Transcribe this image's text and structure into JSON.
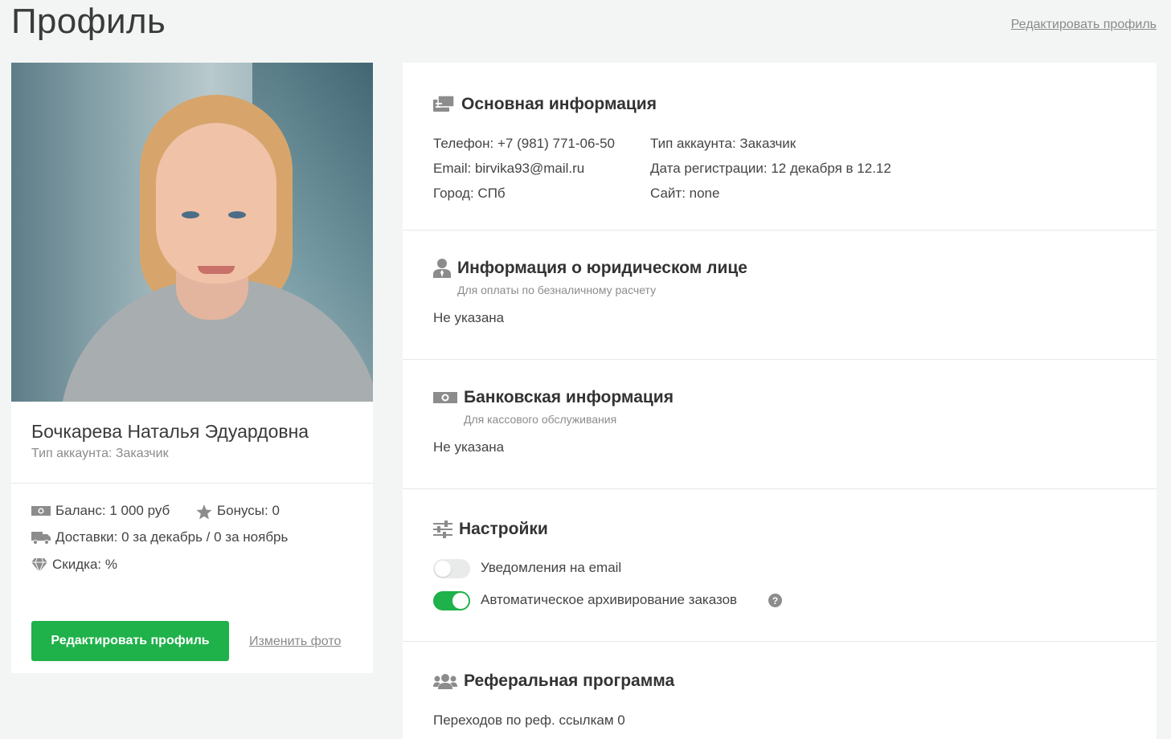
{
  "header": {
    "title": "Профиль",
    "edit_link": "Редактировать профиль"
  },
  "profile": {
    "name": "Бочкарева Наталья Эдуардовна",
    "account_type": "Тип аккаунта: Заказчик",
    "stats": {
      "balance": "Баланс: 1 000 руб",
      "bonuses": "Бонусы: 0",
      "deliveries": "Доставки: 0 за декабрь / 0 за ноябрь",
      "discount": "Скидка: %"
    },
    "edit_button": "Редактировать профиль",
    "change_photo": "Изменить фото"
  },
  "basic_info": {
    "title": "Основная информация",
    "phone": "Телефон: +7 (981) 771-06-50",
    "email": "Email: birvika93@mail.ru",
    "city": "Город: СПб",
    "account_type": "Тип аккаунта: Заказчик",
    "registered": "Дата регистрации: 12 декабря в 12.12",
    "site": "Сайт: none"
  },
  "legal_info": {
    "title": "Информация о юридическом лице",
    "subtitle": "Для оплаты по безналичному расчету",
    "value": "Не указана"
  },
  "bank_info": {
    "title": "Банковская информация",
    "subtitle": "Для кассового обслуживания",
    "value": "Не указана"
  },
  "settings": {
    "title": "Настройки",
    "email_notifications": {
      "label": "Уведомления на email",
      "enabled": false
    },
    "auto_archive": {
      "label": "Автоматическое архивирование заказов",
      "enabled": true
    },
    "help_glyph": "?"
  },
  "referral": {
    "title": "Реферальная программа",
    "clicks": "Переходов по реф. ссылкам 0"
  },
  "colors": {
    "accent_green": "#1fb14a",
    "background": "#f3f5f4",
    "icon_gray": "#8c8c8c"
  }
}
